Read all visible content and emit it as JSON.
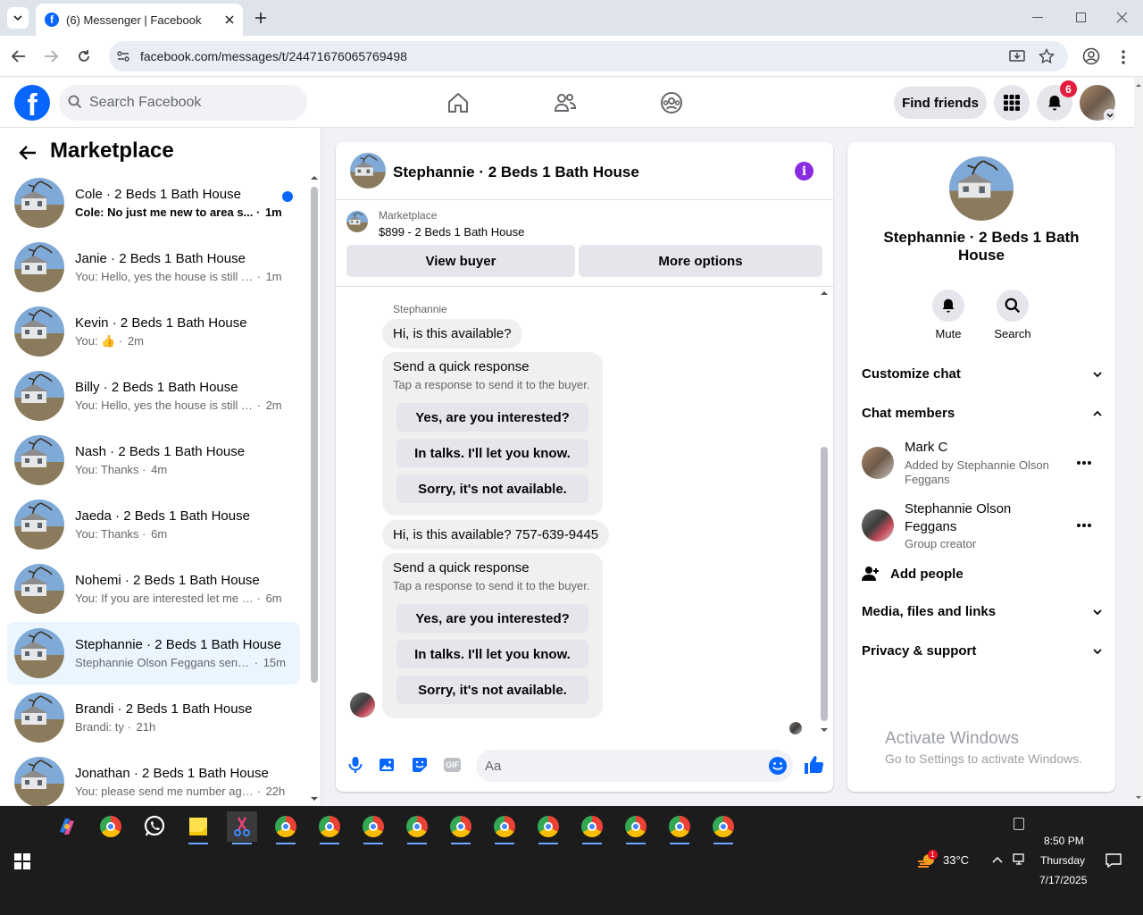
{
  "browser": {
    "tab_title": "(6) Messenger | Facebook",
    "url": "facebook.com/messages/t/24471676065769498"
  },
  "fb": {
    "search_placeholder": "Search Facebook",
    "find_friends": "Find friends",
    "notif_count": "6"
  },
  "left": {
    "title": "Marketplace",
    "conversations": [
      {
        "name": "Cole · 2 Beds 1 Bath House",
        "preview": "Cole: No just me new to area s...",
        "time": "1m",
        "unread": true,
        "selected": false
      },
      {
        "name": "Janie · 2 Beds 1 Bath House",
        "preview": "You: Hello, yes the house is still av...",
        "time": "1m",
        "unread": false,
        "selected": false
      },
      {
        "name": "Kevin · 2 Beds 1 Bath House",
        "preview": "You: 👍",
        "time": "2m",
        "unread": false,
        "selected": false
      },
      {
        "name": "Billy · 2 Beds 1 Bath House",
        "preview": "You: Hello, yes the house is still av...",
        "time": "2m",
        "unread": false,
        "selected": false
      },
      {
        "name": "Nash · 2 Beds 1 Bath House",
        "preview": "You: Thanks",
        "time": "4m",
        "unread": false,
        "selected": false
      },
      {
        "name": "Jaeda · 2 Beds 1 Bath House",
        "preview": "You: Thanks",
        "time": "6m",
        "unread": false,
        "selected": false
      },
      {
        "name": "Nohemi · 2 Beds 1 Bath House",
        "preview": "You: If you are interested let me ha...",
        "time": "6m",
        "unread": false,
        "selected": false
      },
      {
        "name": "Stephannie · 2 Beds 1 Bath House",
        "preview": "Stephannie Olson Feggans sent y...",
        "time": "15m",
        "unread": false,
        "selected": true
      },
      {
        "name": "Brandi · 2 Beds 1 Bath House",
        "preview": "Brandi: ty",
        "time": "21h",
        "unread": false,
        "selected": false
      },
      {
        "name": "Jonathan · 2 Beds 1 Bath House",
        "preview": "You: please send me number agai...",
        "time": "22h",
        "unread": false,
        "selected": false
      }
    ]
  },
  "chat": {
    "title": "Stephannie · 2 Beds 1 Bath House",
    "listing_label": "Marketplace",
    "listing_title": "$899 - 2 Beds 1 Bath House",
    "view_buyer": "View buyer",
    "more_options": "More options",
    "sender": "Stephannie",
    "msg1": "Hi, is this available?",
    "msg2": "Hi, is this available? 757-639-9445",
    "quick_title": "Send a quick response",
    "quick_sub": "Tap a response to send it to the buyer.",
    "quick_options": [
      "Yes, are you interested?",
      "In talks. I'll let you know.",
      "Sorry, it's not available."
    ],
    "composer_placeholder": "Aa"
  },
  "info": {
    "title": "Stephannie · 2 Beds 1 Bath House",
    "mute": "Mute",
    "search": "Search",
    "customize": "Customize chat",
    "members_header": "Chat members",
    "members": [
      {
        "name": "Mark C",
        "sub": "Added by Stephannie Olson Feggans"
      },
      {
        "name": "Stephannie Olson Feggans",
        "sub": "Group creator"
      }
    ],
    "add_people": "Add people",
    "media": "Media, files and links",
    "privacy": "Privacy & support"
  },
  "watermark": {
    "line1": "Activate Windows",
    "line2": "Go to Settings to activate Windows."
  },
  "taskbar": {
    "temp": "33°C",
    "weather_badge": "1",
    "time": "8:50 PM",
    "day": "Thursday",
    "date": "7/17/2025"
  },
  "colors": {
    "accent": "#0866ff",
    "purple": "#8a2be2",
    "selected_bg": "#ebf5ff"
  }
}
